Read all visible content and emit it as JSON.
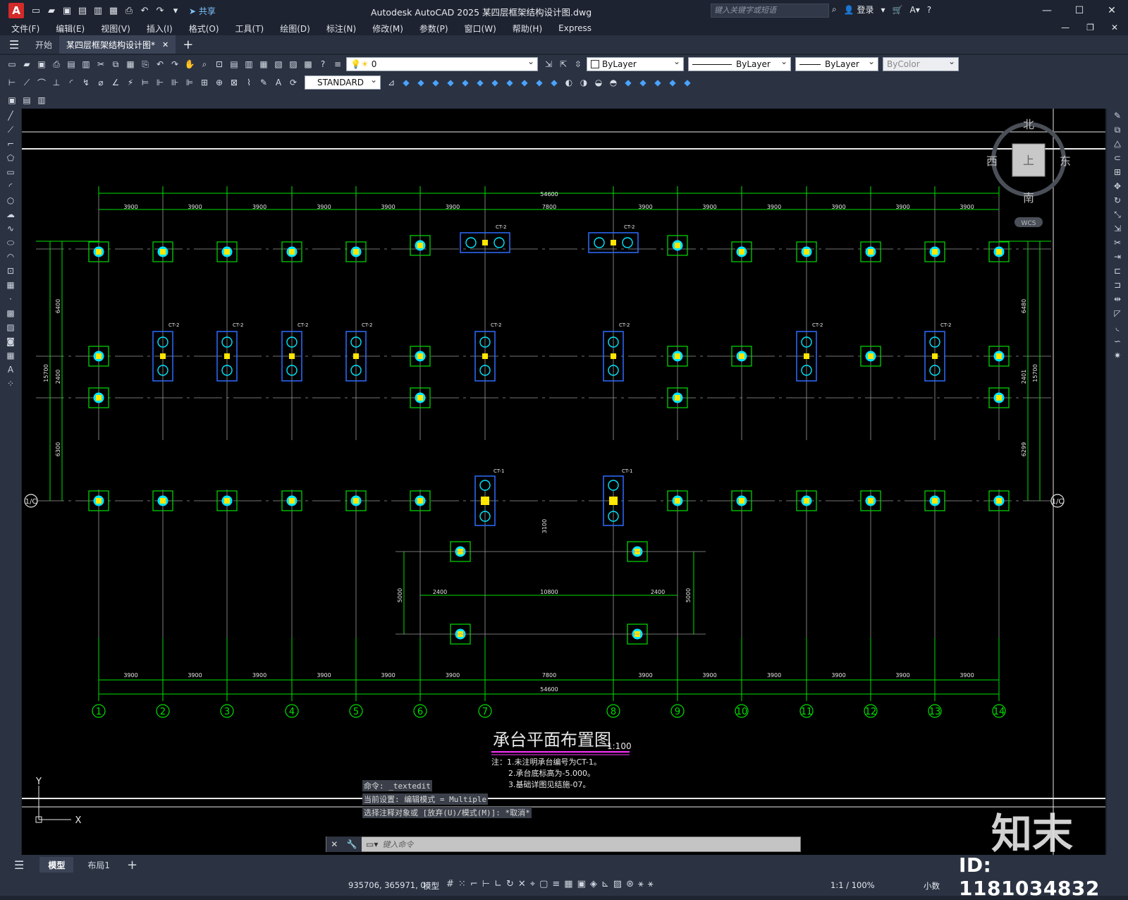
{
  "titlebar": {
    "app_logo": "A",
    "share_label": "共享",
    "title": "Autodesk AutoCAD 2025    某四层框架结构设计图.dwg",
    "search_placeholder": "键入关键字或短语",
    "login_label": "登录",
    "help_label": "?"
  },
  "menu": {
    "items": [
      "文件(F)",
      "编辑(E)",
      "视图(V)",
      "插入(I)",
      "格式(O)",
      "工具(T)",
      "绘图(D)",
      "标注(N)",
      "修改(M)",
      "参数(P)",
      "窗口(W)",
      "帮助(H)",
      "Express"
    ]
  },
  "tabs": {
    "start_label": "开始",
    "doc_label": "某四层框架结构设计图*"
  },
  "toolbar": {
    "layer_value": "0",
    "color_value": "ByLayer",
    "linetype_value": "ByLayer",
    "lineweight_value": "ByLayer",
    "plotstyle_value": "ByColor",
    "textstyle_value": "STANDARD"
  },
  "viewcube": {
    "north": "北",
    "south": "南",
    "east": "东",
    "west": "西",
    "top": "上",
    "wcs": "WCS"
  },
  "drawing": {
    "total_dim": "54600",
    "bay_dims_top": [
      "3900",
      "3900",
      "3900",
      "3900",
      "3900",
      "3900",
      "7800",
      "3900",
      "3900",
      "3900",
      "3900",
      "3900",
      "3900"
    ],
    "bay_dims_bottom": [
      "3900",
      "3900",
      "3900",
      "3900",
      "3900",
      "3900",
      "7800",
      "3900",
      "3900",
      "3900",
      "3900",
      "3900",
      "3900"
    ],
    "axis_labels": [
      "1",
      "2",
      "3",
      "4",
      "5",
      "6",
      "7",
      "8",
      "9",
      "10",
      "11",
      "12",
      "13",
      "14"
    ],
    "axis_c": "1/C",
    "left_dims": [
      "6400",
      "2400",
      "6300",
      "15700"
    ],
    "right_dims": [
      "6480",
      "2401",
      "6299",
      "15700"
    ],
    "middle_dims": [
      "2400",
      "10800",
      "2400",
      "5000",
      "5000",
      "3100"
    ],
    "ct1_label": "CT-1",
    "ct2_label": "CT-2",
    "title": "承台平面布置图",
    "scale": "1:100",
    "notes": [
      "注：1.未注明承台编号为CT-1。",
      "2.承台底标高为-5.000。",
      "3.基础详图见结施-07。"
    ]
  },
  "command": {
    "line1": "命令: _textedit",
    "line2": "当前设置: 编辑模式 = Multiple",
    "line3": "选择注释对象或 [放弃(U)/模式(M)]: *取消*",
    "placeholder": "键入命令"
  },
  "layout_tabs": {
    "model": "模型",
    "layout1": "布局1"
  },
  "status": {
    "coords": "935706, 365971, 0",
    "model": "模型",
    "scale": "1:1 / 100%",
    "units": "小数"
  },
  "watermark": {
    "id": "ID: 1181034832",
    "logo": "知末"
  }
}
